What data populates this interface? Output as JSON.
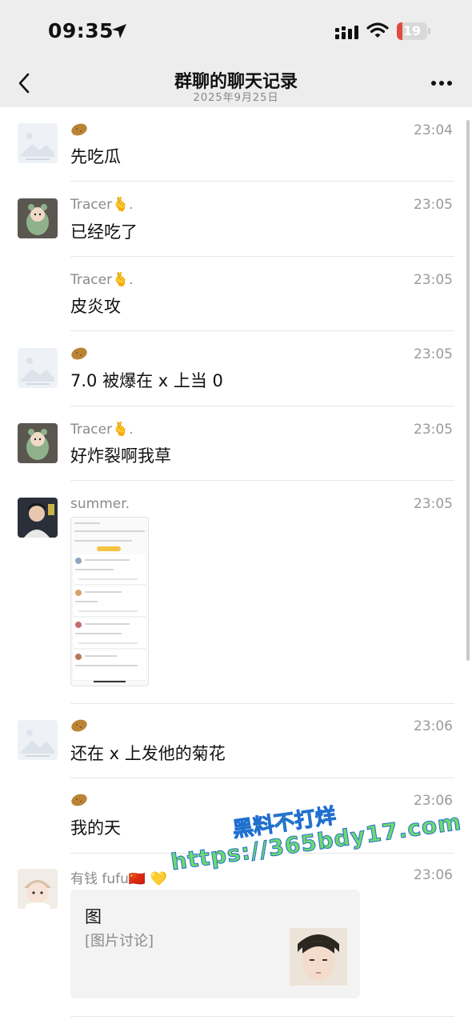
{
  "status_bar": {
    "time": "09:35",
    "battery": "19",
    "battery_percent": 19,
    "icons": [
      "location-arrow-icon",
      "cellular-signal-icon",
      "wifi-icon",
      "battery-icon"
    ]
  },
  "nav": {
    "title": "群聊的聊天记录",
    "subtitle": "2025年9月25日",
    "back_icon": "chevron-left-icon",
    "more_icon": "more-dots-icon"
  },
  "messages": [
    {
      "sender": "",
      "sender_icon": "potato-emoji",
      "avatar": "placeholder-image",
      "time": "23:04",
      "text": "先吃瓜"
    },
    {
      "sender": "Tracer🫰.",
      "avatar": "frog-plush",
      "time": "23:05",
      "text": "已经吃了"
    },
    {
      "sender": "Tracer🫰.",
      "avatar": "none",
      "time": "23:05",
      "text": "皮炎攻"
    },
    {
      "sender": "",
      "sender_icon": "potato-emoji",
      "avatar": "placeholder-image",
      "time": "23:05",
      "text": "7.0 被爆在 x 上当 0"
    },
    {
      "sender": "Tracer🫰.",
      "avatar": "frog-plush",
      "time": "23:05",
      "text": "好炸裂啊我草"
    },
    {
      "sender": "summer.",
      "avatar": "person-photo",
      "time": "23:05",
      "text": "",
      "attachment": "screenshot-image"
    },
    {
      "sender": "",
      "sender_icon": "potato-emoji",
      "avatar": "placeholder-image",
      "time": "23:06",
      "text": "还在 x 上发他的菊花"
    },
    {
      "sender": "",
      "sender_icon": "potato-emoji",
      "avatar": "none",
      "time": "23:06",
      "text": "我的天"
    },
    {
      "sender": "有钱 fufu🇨🇳 💛",
      "avatar": "doll-photo",
      "time": "23:06",
      "text": ""
    }
  ],
  "card": {
    "title": "图",
    "subtitle": "[图片讨论]",
    "image": "anime-face-thumbnail"
  },
  "watermark": {
    "line1": "黑料不打烊",
    "line2": "https://365bdy17.com"
  },
  "colors": {
    "header_bg": "#ededed",
    "battery_red": "#e04a3f",
    "watermark_green": "#6fd96b"
  }
}
